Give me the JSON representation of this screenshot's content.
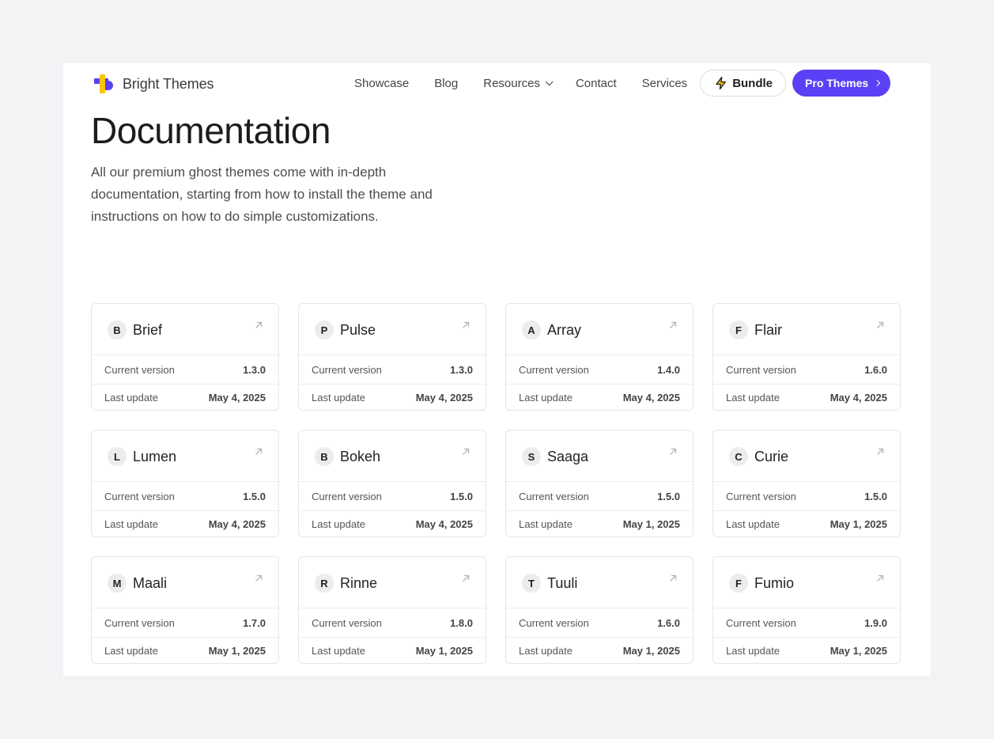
{
  "brand": {
    "name": "Bright Themes"
  },
  "nav": {
    "showcase": "Showcase",
    "blog": "Blog",
    "resources": "Resources",
    "contact": "Contact",
    "services": "Services",
    "bundle": "Bundle",
    "pro": "Pro Themes"
  },
  "hero": {
    "title": "Documentation",
    "intro": "All our premium ghost themes come with in-depth documentation, starting from how to install the theme and instructions on how to do simple customizations."
  },
  "labels": {
    "version": "Current version",
    "update": "Last update"
  },
  "themes": [
    {
      "initial": "B",
      "name": "Brief",
      "version": "1.3.0",
      "updated": "May 4, 2025"
    },
    {
      "initial": "P",
      "name": "Pulse",
      "version": "1.3.0",
      "updated": "May 4, 2025"
    },
    {
      "initial": "A",
      "name": "Array",
      "version": "1.4.0",
      "updated": "May 4, 2025"
    },
    {
      "initial": "F",
      "name": "Flair",
      "version": "1.6.0",
      "updated": "May 4, 2025"
    },
    {
      "initial": "L",
      "name": "Lumen",
      "version": "1.5.0",
      "updated": "May 4, 2025"
    },
    {
      "initial": "B",
      "name": "Bokeh",
      "version": "1.5.0",
      "updated": "May 4, 2025"
    },
    {
      "initial": "S",
      "name": "Saaga",
      "version": "1.5.0",
      "updated": "May 1, 2025"
    },
    {
      "initial": "C",
      "name": "Curie",
      "version": "1.5.0",
      "updated": "May 1, 2025"
    },
    {
      "initial": "M",
      "name": "Maali",
      "version": "1.7.0",
      "updated": "May 1, 2025"
    },
    {
      "initial": "R",
      "name": "Rinne",
      "version": "1.8.0",
      "updated": "May 1, 2025"
    },
    {
      "initial": "T",
      "name": "Tuuli",
      "version": "1.6.0",
      "updated": "May 1, 2025"
    },
    {
      "initial": "F",
      "name": "Fumio",
      "version": "1.9.0",
      "updated": "May 1, 2025"
    }
  ],
  "colors": {
    "accent": "#5b41f5",
    "logo_yellow": "#f7c600",
    "logo_purple": "#5b41f5",
    "bolt": "#f5b800"
  }
}
